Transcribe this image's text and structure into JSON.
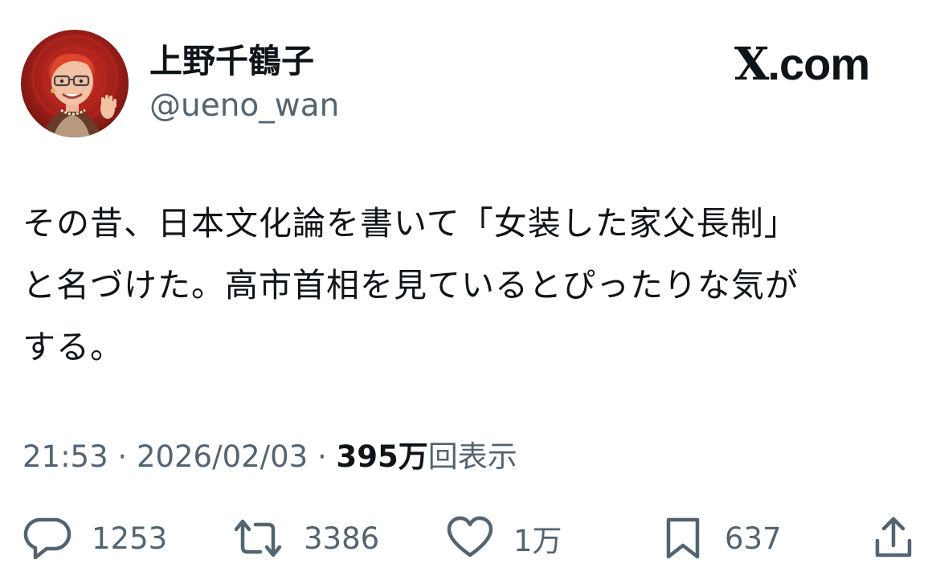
{
  "author": {
    "name": "上野千鶴子",
    "handle": "@ueno_wan"
  },
  "brand": {
    "x_mark": "X",
    "suffix": ".com"
  },
  "tweet": {
    "lines": [
      "その昔、日本文化論を書いて「女装した家父長制」",
      "と名づけた。高市首相を見ているとぴったりな気が",
      "する。"
    ]
  },
  "meta": {
    "time": "21:53",
    "separator": " · ",
    "date": "2026/02/03",
    "views_count": "395万",
    "views_label": "回表示"
  },
  "actions": {
    "replies": "1253",
    "reposts": "3386",
    "likes": "1万",
    "bookmarks": "637"
  },
  "colors": {
    "text_primary": "#0f1419",
    "text_secondary": "#536471",
    "avatar_background": "#a3201a"
  },
  "icons": {
    "reply": "reply-icon",
    "repost": "repost-icon",
    "like": "heart-icon",
    "bookmark": "bookmark-icon",
    "share": "share-icon"
  }
}
